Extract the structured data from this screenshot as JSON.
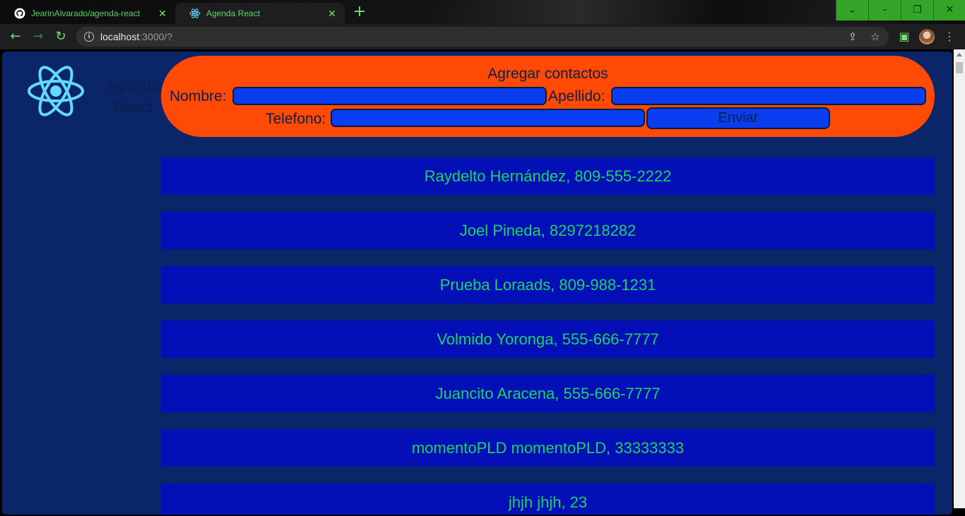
{
  "browser": {
    "tabs": [
      {
        "title": "JearinAlvarado/agenda-react",
        "icon": "github-icon",
        "close": "✕"
      },
      {
        "title": "Agenda React",
        "icon": "react-icon",
        "close": "✕"
      }
    ],
    "new_tab": "+",
    "window_controls": {
      "dropdown": "⌄",
      "minimize": "–",
      "restore": "❐",
      "close": "✕"
    },
    "url": {
      "host": "localhost",
      "rest": ":3000/?"
    }
  },
  "app": {
    "brand": "Agenda React",
    "form": {
      "title": "Agregar contactos",
      "nombre_label": "Nombre:",
      "apellido_label": "Apellido:",
      "telefono_label": "Telefono:",
      "nombre_value": "",
      "apellido_value": "",
      "telefono_value": "",
      "submit": "Enviar"
    },
    "contacts": [
      "Raydelto Hernández, 809-555-2222",
      "Joel Pineda, 8297218282",
      "Prueba Loraads, 809-988-1231",
      "Volmido Yoronga, 555-666-7777",
      "Juancito Aracena, 555-666-7777",
      "momentoPLD momentoPLD, 33333333",
      "jhjh jhjh, 23"
    ]
  },
  "colors": {
    "page_bg": "#0a2668",
    "form_bg": "#ff4a06",
    "input_bg": "#0b3df0",
    "contact_bg": "#050fb7",
    "contact_text": "#19d45e",
    "chrome_accent": "#6ee07a"
  }
}
